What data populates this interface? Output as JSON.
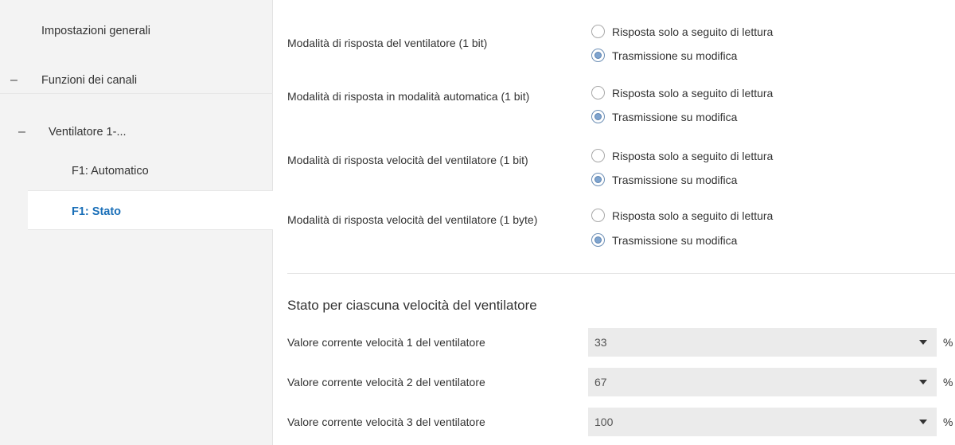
{
  "sidebar": {
    "general": "Impostazioni generali",
    "channels": "Funzioni dei canali",
    "fan": "Ventilatore 1-...",
    "automatic": "F1: Automatico",
    "status": "F1: Stato",
    "dash": "–"
  },
  "params": [
    {
      "label": "Modalità di risposta del ventilatore (1 bit)",
      "option1": "Risposta solo a seguito di lettura",
      "option2": "Trasmissione su modifica",
      "selected": "option2"
    },
    {
      "label": "Modalità di risposta in modalità automatica (1 bit)",
      "option1": "Risposta solo a seguito di lettura",
      "option2": "Trasmissione su modifica",
      "selected": "option2"
    },
    {
      "label": "Modalità di risposta velocità del ventilatore (1 bit)",
      "option1": "Risposta solo a seguito di lettura",
      "option2": "Trasmissione su modifica",
      "selected": "option2"
    },
    {
      "label": "Modalità di risposta velocità del ventilatore (1 byte)",
      "option1": "Risposta solo a seguito di lettura",
      "option2": "Trasmissione su modifica",
      "selected": "option2"
    }
  ],
  "section": {
    "title": "Stato per ciascuna velocità del ventilatore"
  },
  "speeds": [
    {
      "label": "Valore corrente velocità 1 del ventilatore",
      "value": "33",
      "unit": "%"
    },
    {
      "label": "Valore corrente velocità 2 del ventilatore",
      "value": "67",
      "unit": "%"
    },
    {
      "label": "Valore corrente velocità 3 del ventilatore",
      "value": "100",
      "unit": "%"
    }
  ],
  "colors": {
    "active_nav": "#1a6fb8",
    "sidebar_bg": "#f3f3f3",
    "select_bg": "#ebebeb"
  }
}
